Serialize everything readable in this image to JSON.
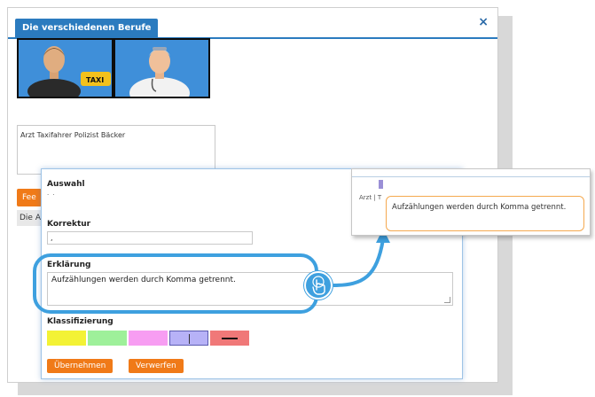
{
  "window": {
    "title": "Die verschiedenen Berufe",
    "close_symbol": "×"
  },
  "pictures": [
    {
      "name": "taxi driver",
      "sign_text": "TAXI"
    },
    {
      "name": "doctor"
    }
  ],
  "answer": {
    "text": "Arzt Taxifahrer Polizist Bäcker"
  },
  "feedback_button": {
    "label": "Fee"
  },
  "list_row": {
    "label": "Die A"
  },
  "dialog": {
    "auswahl_label": "Auswahl",
    "auswahl_value": ". .",
    "korrektur_label": "Korrektur",
    "korrektur_value": ",",
    "erklaerung_label": "Erklärung",
    "erklaerung_value": "Aufzählungen werden durch Komma getrennt.",
    "klassifizierung_label": "Klassifizierung",
    "swatches": [
      {
        "color": "#f3f235",
        "name": "yellow"
      },
      {
        "color": "#9ef09a",
        "name": "green"
      },
      {
        "color": "#f79df2",
        "name": "pink"
      },
      {
        "color": "#b7b2f7",
        "name": "lavender",
        "selected": true
      },
      {
        "color": "#f07878",
        "name": "red-strike"
      }
    ],
    "apply_label": "Übernehmen",
    "discard_label": "Verwerfen"
  },
  "preview": {
    "answer_text": "Arzt | T",
    "tooltip_text": "Aufzählungen werden durch Komma getrennt."
  },
  "colors": {
    "accent_blue": "#2b7bbf",
    "highlight_blue": "#3ea0df",
    "orange": "#f07a18"
  }
}
